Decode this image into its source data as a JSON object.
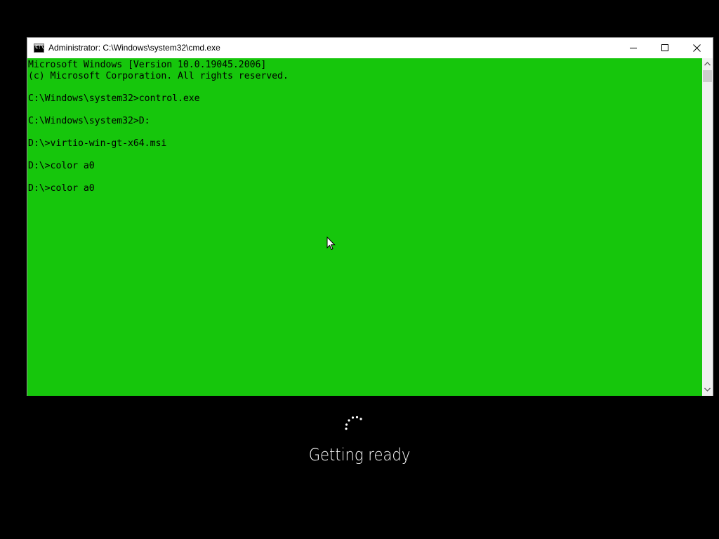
{
  "window": {
    "title": "Administrator: C:\\Windows\\system32\\cmd.exe",
    "icon": "cmd-icon",
    "controls": {
      "minimize_icon": "minimize-icon",
      "maximize_icon": "maximize-icon",
      "close_icon": "close-icon"
    }
  },
  "console": {
    "background_color": "#16c60c",
    "text_color": "#000000",
    "lines": [
      "Microsoft Windows [Version 10.0.19045.2006]",
      "(c) Microsoft Corporation. All rights reserved.",
      "",
      "C:\\Windows\\system32>control.exe",
      "",
      "C:\\Windows\\system32>D:",
      "",
      "D:\\>virtio-win-gt-x64.msi",
      "",
      "D:\\>color a0",
      "",
      "D:\\>color a0"
    ]
  },
  "scrollbar": {
    "up_icon": "chevron-up-icon",
    "down_icon": "chevron-down-icon"
  },
  "cursor": {
    "icon": "arrow-cursor-icon"
  },
  "status": {
    "spinner_icon": "loading-spinner-icon",
    "text": "Getting ready"
  }
}
